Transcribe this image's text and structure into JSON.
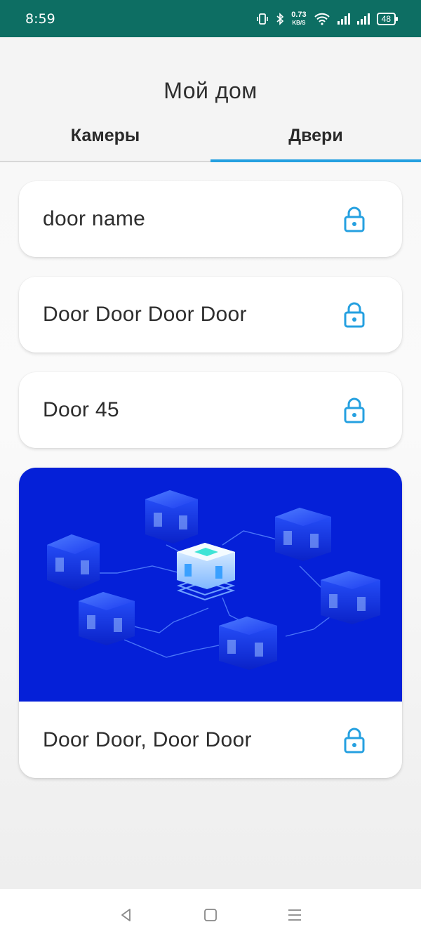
{
  "status_bar": {
    "time": "8:59",
    "speed_value": "0.73",
    "speed_unit": "KB/S",
    "battery": "48"
  },
  "header": {
    "title": "Мой дом",
    "tabs": [
      {
        "label": "Камеры",
        "active": false
      },
      {
        "label": "Двери",
        "active": true
      }
    ]
  },
  "doors": [
    {
      "name": "door name",
      "icon": "lock-icon"
    },
    {
      "name": "Door Door Door Door",
      "icon": "lock-icon"
    },
    {
      "name": "Door 45",
      "icon": "lock-icon"
    },
    {
      "name": "Door Door, Door Door",
      "icon": "lock-icon",
      "has_image": true
    }
  ],
  "colors": {
    "status_bar": "#0d6e63",
    "accent": "#25a0e0",
    "image_background": "#0520d8"
  },
  "nav_bar": {
    "buttons": [
      "back-icon",
      "home-icon",
      "menu-icon"
    ]
  }
}
